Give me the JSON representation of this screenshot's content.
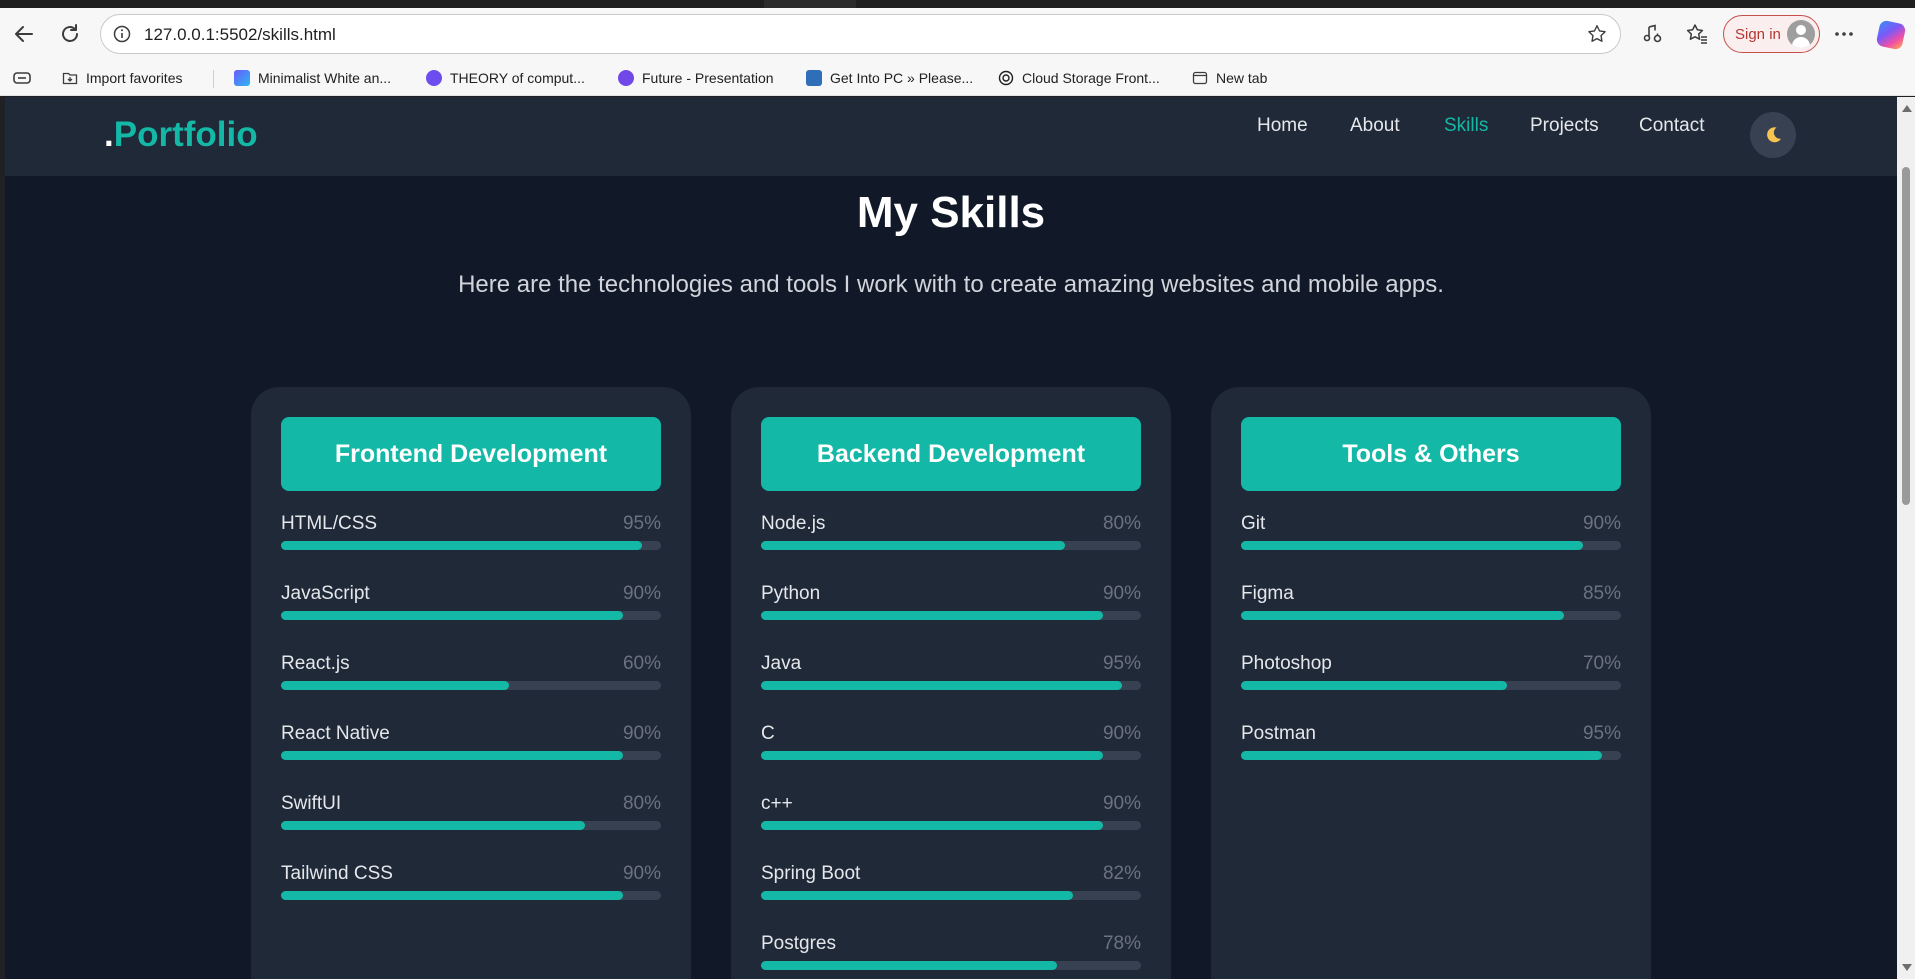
{
  "browser": {
    "url": "127.0.0.1:5502/skills.html",
    "sign_in_label": "Sign in",
    "bookmarks": [
      {
        "label": "Import favorites",
        "icon": "import-favorites-icon"
      },
      {
        "label": "Minimalist White an...",
        "icon": "minimalist-site-icon"
      },
      {
        "label": "THEORY of comput...",
        "icon": "theory-site-icon"
      },
      {
        "label": "Future - Presentation",
        "icon": "future-site-icon"
      },
      {
        "label": "Get Into PC » Please...",
        "icon": "getintopc-site-icon"
      },
      {
        "label": "Cloud Storage Front...",
        "icon": "openai-icon"
      },
      {
        "label": "New tab",
        "icon": "new-tab-icon"
      }
    ]
  },
  "site": {
    "logo_dot": ".",
    "logo_text": "Portfolio",
    "nav": [
      "Home",
      "About",
      "Skills",
      "Projects",
      "Contact"
    ],
    "active_nav": "Skills",
    "theme_icon": "moon-icon"
  },
  "page": {
    "title": "My Skills",
    "subtitle": "Here are the technologies and tools I work with to create amazing websites and mobile apps."
  },
  "categories": [
    {
      "title": "Frontend Development",
      "skills": [
        {
          "name": "HTML/CSS",
          "percent": "95%",
          "value": 95
        },
        {
          "name": "JavaScript",
          "percent": "90%",
          "value": 90
        },
        {
          "name": "React.js",
          "percent": "60%",
          "value": 60
        },
        {
          "name": "React Native",
          "percent": "90%",
          "value": 90
        },
        {
          "name": "SwiftUI",
          "percent": "80%",
          "value": 80
        },
        {
          "name": "Tailwind CSS",
          "percent": "90%",
          "value": 90
        }
      ]
    },
    {
      "title": "Backend Development",
      "skills": [
        {
          "name": "Node.js",
          "percent": "80%",
          "value": 80
        },
        {
          "name": "Python",
          "percent": "90%",
          "value": 90
        },
        {
          "name": "Java",
          "percent": "95%",
          "value": 95
        },
        {
          "name": "C",
          "percent": "90%",
          "value": 90
        },
        {
          "name": "c++",
          "percent": "90%",
          "value": 90
        },
        {
          "name": "Spring Boot",
          "percent": "82%",
          "value": 82
        },
        {
          "name": "Postgres",
          "percent": "78%",
          "value": 78
        }
      ]
    },
    {
      "title": "Tools & Others",
      "skills": [
        {
          "name": "Git",
          "percent": "90%",
          "value": 90
        },
        {
          "name": "Figma",
          "percent": "85%",
          "value": 85
        },
        {
          "name": "Photoshop",
          "percent": "70%",
          "value": 70
        },
        {
          "name": "Postman",
          "percent": "95%",
          "value": 95
        }
      ]
    }
  ],
  "colors": {
    "accent": "#14b8a6",
    "page_bg": "#111827",
    "card_bg": "#1f2937",
    "track": "#374151"
  }
}
